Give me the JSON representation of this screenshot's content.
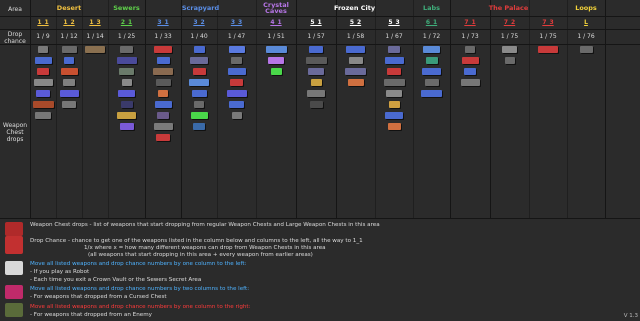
{
  "row_labels": {
    "area": "Area",
    "drop_chance": "Drop chance",
    "weapon_drops": "Weapon Chest drops"
  },
  "areas": [
    {
      "name": "Desert",
      "color": "#f0c040"
    },
    {
      "name": "Sewers",
      "color": "#5ecf4a"
    },
    {
      "name": "Scrapyard",
      "color": "#5b8fe8"
    },
    {
      "name": "Crystal Caves",
      "color": "#b675e6"
    },
    {
      "name": "Frozen City",
      "color": "#ffffff"
    },
    {
      "name": "Labs",
      "color": "#3fae7b"
    },
    {
      "name": "The Palace",
      "color": "#e23c3c"
    },
    {
      "name": "Loops",
      "color": "#f2d23a"
    }
  ],
  "levels": [
    "1_1",
    "1_2",
    "1_3",
    "2_1",
    "3_1",
    "3_2",
    "3_3",
    "4_1",
    "5_1",
    "5_2",
    "5_3",
    "6_1",
    "7_1",
    "7_2",
    "7_3",
    "L"
  ],
  "chances": [
    "1 / 9",
    "1 / 12",
    "1 / 14",
    "1 / 25",
    "1 / 33",
    "1 / 40",
    "1 / 47",
    "1 / 51",
    "1 / 57",
    "1 / 58",
    "1 / 67",
    "1 / 72",
    "1 / 73",
    "1 / 75",
    "1 / 75",
    "1 / 76"
  ],
  "legend": [
    {
      "text": "Weapon Chest drops - list of weapons that start dropping from regular Weapon Chests and Large Weapon Chests in this area",
      "color": "#dddddd",
      "icon": "weapon-chest-icon"
    },
    {
      "text": "Drop Chance - chance to get one of the weapons listed in the column below and columns to the left, all the way to 1_1",
      "color": "#dddddd",
      "icon": "large-weapon-chest-icon"
    },
    {
      "text": "1/x where x = how many different weapons can drop from Weapon Chests in this area",
      "color": "#dddddd"
    },
    {
      "text": "(all weapons that start dropping in this area + every weapon from earlier areas)",
      "color": "#dddddd"
    },
    {
      "text": "Move all listed weapons and drop chance numbers by one column to the left:",
      "color": "#4fb3ff",
      "icon": "robot-icon"
    },
    {
      "text": "- If you play as Robot",
      "color": "#dddddd"
    },
    {
      "text": "- Each time you exit a Crown Vault or the Sewers Secret Area",
      "color": "#dddddd"
    },
    {
      "text": "Move all listed weapons and drop chance numbers by two columns to the left:",
      "color": "#4fb3ff",
      "icon": "cursed-chest-icon"
    },
    {
      "text": "- For weapons that dropped from a Cursed Chest",
      "color": "#dddddd"
    },
    {
      "text": "Move all listed weapons and drop chance numbers by one column to the right:",
      "color": "#ff3b3b",
      "icon": "enemy-icon"
    },
    {
      "text": "- For weapons that dropped from an Enemy",
      "color": "#dddddd"
    }
  ],
  "version": "V 1.3"
}
